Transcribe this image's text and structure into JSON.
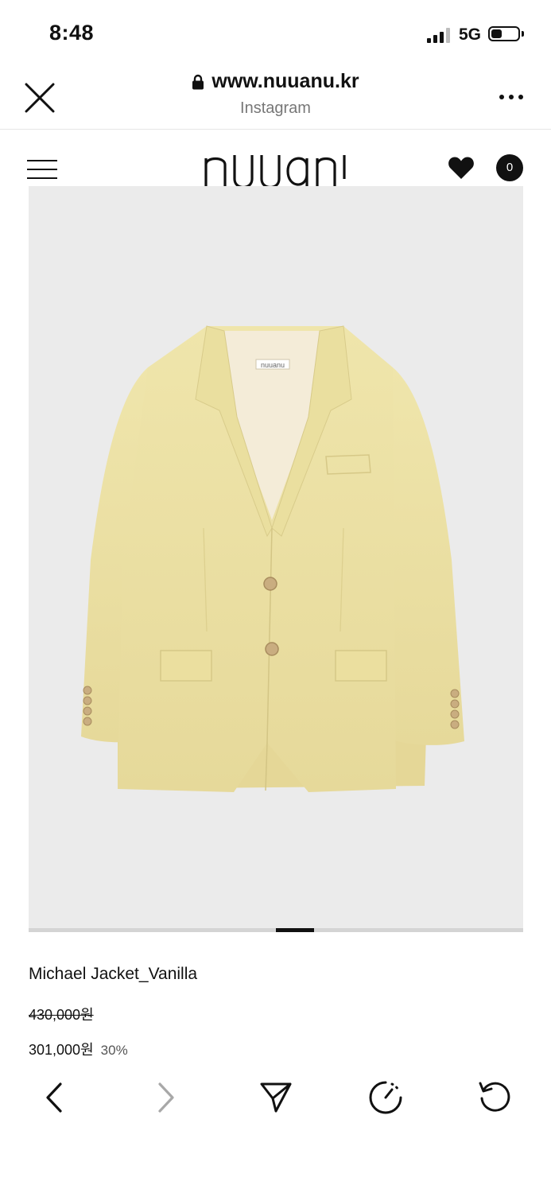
{
  "status_bar": {
    "time": "8:48",
    "network": "5G"
  },
  "browser": {
    "url": "www.nuuanu.kr",
    "source": "Instagram",
    "icons": [
      "close-icon",
      "lock-icon",
      "more-icon"
    ]
  },
  "site_header": {
    "logo": "nuuanu",
    "cart_count": "0",
    "icons": [
      "menu-icon",
      "heart-icon"
    ]
  },
  "product": {
    "image_alt": "Michael Jacket_Vanilla",
    "label_tag": "nuuanu",
    "name": "Michael Jacket_Vanilla",
    "original_price": "430,000원",
    "sale_price": "301,000원",
    "discount": "30%",
    "colors": {
      "background": "#ebebeb",
      "jacket": "#ece1a3",
      "lining": "#f3ead6"
    }
  },
  "carousel": {
    "position": 0.538
  },
  "toolbar": {
    "icons": [
      "back-icon",
      "forward-icon",
      "share-icon",
      "timer-icon",
      "reload-icon"
    ]
  }
}
